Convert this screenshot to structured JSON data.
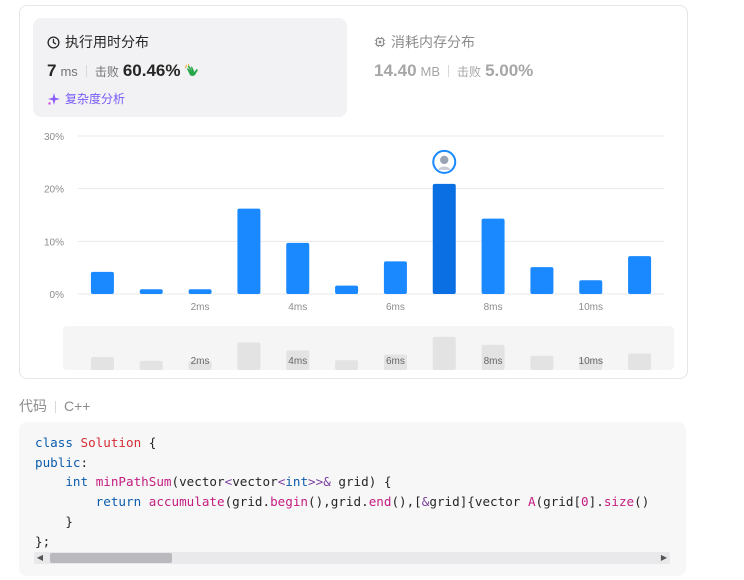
{
  "runtime": {
    "title": "执行用时分布",
    "value": "7",
    "unit": "ms",
    "beat_label": "击败",
    "beat_value": "60.46%",
    "complexity_label": "复杂度分析"
  },
  "memory": {
    "title": "消耗内存分布",
    "value": "14.40",
    "unit": "MB",
    "beat_label": "击败",
    "beat_value": "5.00%"
  },
  "chart_data": {
    "type": "bar",
    "ylabel": "",
    "xlabel": "",
    "ylim": [
      0,
      30
    ],
    "y_ticks": [
      "0%",
      "10%",
      "20%",
      "30%"
    ],
    "x_ticks": [
      "2ms",
      "4ms",
      "6ms",
      "8ms",
      "10ms"
    ],
    "categories": [
      "0ms",
      "1ms",
      "2ms",
      "3ms",
      "4ms",
      "5ms",
      "6ms",
      "7ms",
      "8ms",
      "9ms",
      "10ms",
      "11ms"
    ],
    "values": [
      4.2,
      0.9,
      0.9,
      16.2,
      9.7,
      1.6,
      6.2,
      20.9,
      14.3,
      5.1,
      2.6,
      7.2
    ],
    "highlight_index": 7,
    "colors": {
      "bar": "#1a88ff",
      "highlight": "#0a6fe3",
      "grid": "#e8e8e8",
      "overview_bar": "#e3e3e3"
    }
  },
  "code_section": {
    "label": "代码",
    "language": "C++"
  },
  "icons": {
    "clock": "clock-icon",
    "memory": "chip-icon",
    "clap": "clap-icon",
    "sparkle": "sparkle-icon",
    "avatar": "avatar"
  }
}
